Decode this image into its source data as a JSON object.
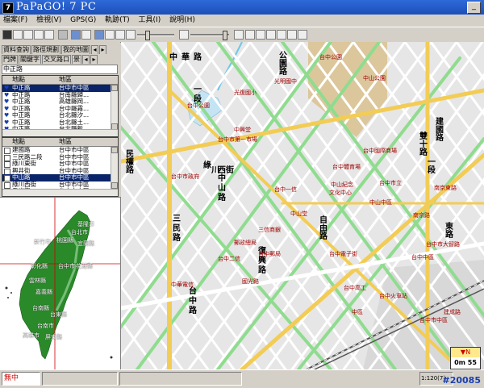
{
  "window": {
    "title": "PaPaGO! 7 PC",
    "icon_label": "7",
    "min_glyph": "_"
  },
  "menu": [
    {
      "label": "檔案(F)"
    },
    {
      "label": "檢視(V)"
    },
    {
      "label": "GPS(G)"
    },
    {
      "label": "軌跡(T)"
    },
    {
      "label": "工具(I)"
    },
    {
      "label": "說明(H)"
    }
  ],
  "panel": {
    "tabs_row1": [
      "資料查詢",
      "路徑規劃",
      "我的地圖"
    ],
    "tabs_row2": [
      "門牌",
      "關鍵字",
      "交叉路口",
      "景"
    ],
    "search_value": "中正路",
    "list1": {
      "col_name": "地點",
      "col_area": "地區",
      "rows": [
        {
          "name": "中正路",
          "area": "台中市中區",
          "selected": true
        },
        {
          "name": "中正路",
          "area": "台南縣歸...",
          "selected": false
        },
        {
          "name": "中正路",
          "area": "高雄縣岡...",
          "selected": false
        },
        {
          "name": "中正路",
          "area": "台中縣霧...",
          "selected": false
        },
        {
          "name": "中正路",
          "area": "台北縣汐...",
          "selected": false
        },
        {
          "name": "中正路",
          "area": "台北縣土...",
          "selected": false
        },
        {
          "name": "中正路",
          "area": "台北縣新...",
          "selected": false
        },
        {
          "name": "中正路",
          "area": "台北縣新...",
          "selected": false
        }
      ]
    },
    "list2": {
      "col_name": "地點",
      "col_area": "地區",
      "rows": [
        {
          "name": "建國路",
          "area": "台中市中區",
          "selected": false
        },
        {
          "name": "三民路二段",
          "area": "台中市中區",
          "selected": false
        },
        {
          "name": "綠川東街",
          "area": "台中市中區",
          "selected": false
        },
        {
          "name": "興井街",
          "area": "台中市中區",
          "selected": false
        },
        {
          "name": "中山路",
          "area": "台中市中區",
          "selected": true
        },
        {
          "name": "綠川西街",
          "area": "台中市中區",
          "selected": false
        },
        {
          "name": "電光街",
          "area": "台中市中區",
          "selected": false
        }
      ]
    }
  },
  "overview": {
    "labels": [
      {
        "text": "基隆市"
      },
      {
        "text": "台北市"
      },
      {
        "text": "桃園縣"
      },
      {
        "text": "新竹市"
      },
      {
        "text": "宜蘭縣"
      },
      {
        "text": "彰化縣"
      },
      {
        "text": "台中市"
      },
      {
        "text": "花蓮縣"
      },
      {
        "text": "雲林縣"
      },
      {
        "text": "嘉義縣"
      },
      {
        "text": "台南縣"
      },
      {
        "text": "台東縣"
      },
      {
        "text": "台南市"
      },
      {
        "text": "高雄市"
      },
      {
        "text": "屏東縣"
      }
    ]
  },
  "map": {
    "road_chars": [
      {
        "text": "中"
      },
      {
        "text": "華"
      },
      {
        "text": "路"
      },
      {
        "text": "公"
      },
      {
        "text": "園"
      },
      {
        "text": "路"
      },
      {
        "text": "一"
      },
      {
        "text": "段"
      },
      {
        "text": "中"
      },
      {
        "text": "山"
      },
      {
        "text": "路"
      },
      {
        "text": "綠"
      },
      {
        "text": "川"
      },
      {
        "text": "西"
      },
      {
        "text": "街"
      },
      {
        "text": "民"
      },
      {
        "text": "權"
      },
      {
        "text": "路"
      },
      {
        "text": "自"
      },
      {
        "text": "由"
      },
      {
        "text": "路"
      },
      {
        "text": "復"
      },
      {
        "text": "興"
      },
      {
        "text": "路"
      },
      {
        "text": "台"
      },
      {
        "text": "中"
      },
      {
        "text": "路"
      },
      {
        "text": "建"
      },
      {
        "text": "國"
      },
      {
        "text": "路"
      },
      {
        "text": "三"
      },
      {
        "text": "民"
      },
      {
        "text": "路"
      },
      {
        "text": "雙"
      },
      {
        "text": "十"
      },
      {
        "text": "路"
      },
      {
        "text": "一"
      },
      {
        "text": "段"
      },
      {
        "text": "東"
      },
      {
        "text": "路"
      }
    ],
    "place_labels": [
      {
        "text": "台中公園"
      },
      {
        "text": "光明國中"
      },
      {
        "text": "中山公園"
      },
      {
        "text": "台中市第一市場"
      },
      {
        "text": "台中公園"
      },
      {
        "text": "光復國小"
      },
      {
        "text": "中興堂"
      },
      {
        "text": "台中市政府"
      },
      {
        "text": "台中一信"
      },
      {
        "text": "中華電信"
      },
      {
        "text": "台中二信"
      },
      {
        "text": "中山堂"
      },
      {
        "text": "台中電子街"
      },
      {
        "text": "國光路"
      },
      {
        "text": "台中高工"
      },
      {
        "text": "三信商銀"
      },
      {
        "text": "郵政總局"
      },
      {
        "text": "台中郵局"
      },
      {
        "text": "台中火車站"
      },
      {
        "text": "台中體育場"
      },
      {
        "text": "中山紀念"
      },
      {
        "text": "文化中心"
      },
      {
        "text": "台中國際商場"
      },
      {
        "text": "台中市立"
      },
      {
        "text": "中山中區"
      },
      {
        "text": "南京路"
      },
      {
        "text": "南京東路"
      },
      {
        "text": "台中市大智路"
      },
      {
        "text": "台中中區"
      },
      {
        "text": "中區"
      },
      {
        "text": "台中市中區"
      },
      {
        "text": "建成路"
      }
    ]
  },
  "status": {
    "left_label": "無中",
    "scale": "1:120",
    "coord_label": "1:120(7)",
    "compass_top": "▼N",
    "compass_dist": "0m 55",
    "watermark": "#20085"
  },
  "colors": {
    "title_bar": "#2f6ad9",
    "map_bg": "#e8e8e8",
    "road_white": "#ffffff",
    "road_green": "#8fdc8f",
    "road_yellow": "#f2cc55",
    "park": "#ddc9a0",
    "water": "#c8e6f6",
    "selection": "#0a246a"
  }
}
